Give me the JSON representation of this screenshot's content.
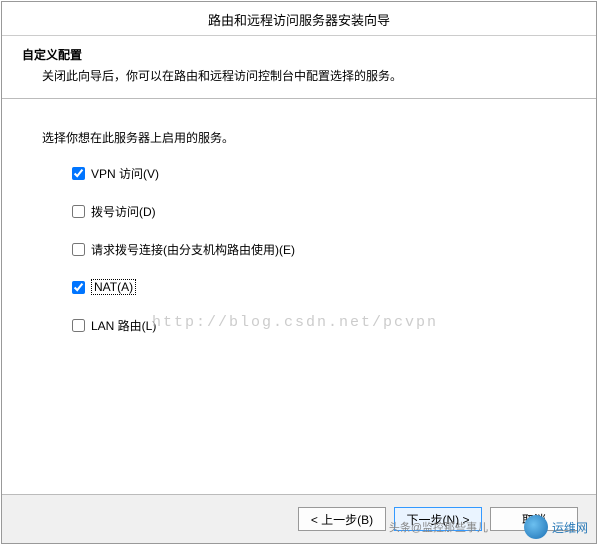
{
  "title": "路由和远程访问服务器安装向导",
  "header": {
    "title": "自定义配置",
    "desc": "关闭此向导后，你可以在路由和远程访问控制台中配置选择的服务。"
  },
  "body": {
    "instruction": "选择你想在此服务器上启用的服务。",
    "options": [
      {
        "label": "VPN 访问(V)",
        "checked": true,
        "focused": false
      },
      {
        "label": "拨号访问(D)",
        "checked": false,
        "focused": false
      },
      {
        "label": "请求拨号连接(由分支机构路由使用)(E)",
        "checked": false,
        "focused": false
      },
      {
        "label": "NAT(A)",
        "checked": true,
        "focused": true
      },
      {
        "label": "LAN 路由(L)",
        "checked": false,
        "focused": false
      }
    ]
  },
  "watermark": "http://blog.csdn.net/pcvpn",
  "footer": {
    "back": "< 上一步(B)",
    "next": "下一步(N) >",
    "cancel": "取消"
  },
  "overlay": {
    "source": "头条@监控那些事儿",
    "brand": "运维网"
  }
}
